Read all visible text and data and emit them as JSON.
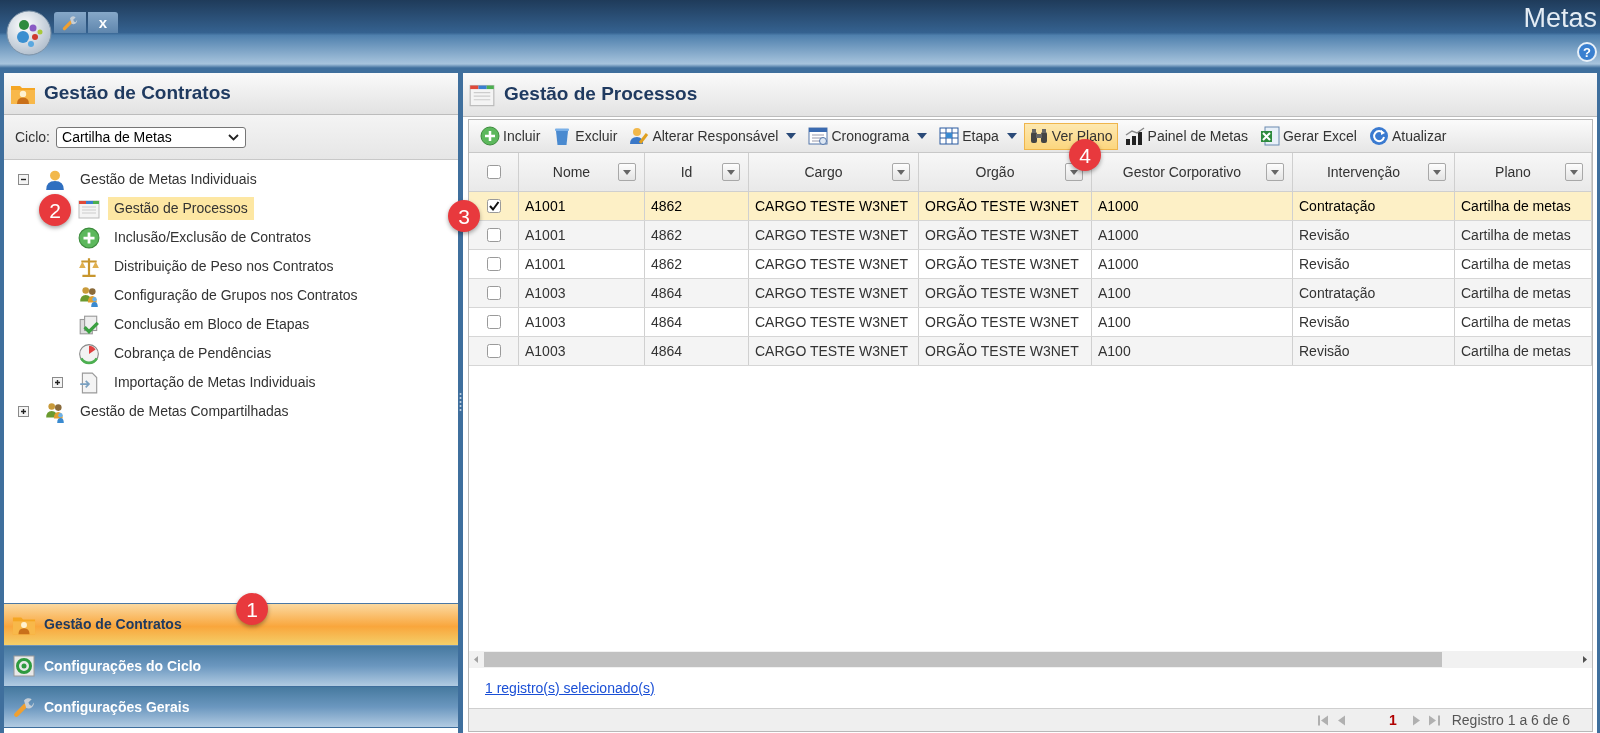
{
  "header": {
    "title": "Metas",
    "close_tab": "x",
    "help": "?"
  },
  "left_panel": {
    "title": "Gestão de Contratos",
    "cycle": {
      "label": "Ciclo:",
      "value": "Cartilha de Metas"
    },
    "tree": [
      {
        "label": "Gestão de Metas Individuais",
        "kind": "branch",
        "expanded": true,
        "selected": false,
        "children": [
          {
            "label": "Gestão de Processos",
            "kind": "leaf",
            "selected": true
          },
          {
            "label": "Inclusão/Exclusão de Contratos",
            "kind": "leaf",
            "selected": false
          },
          {
            "label": "Distribuição de Peso nos Contratos",
            "kind": "leaf",
            "selected": false
          },
          {
            "label": "Configuração de Grupos nos Contratos",
            "kind": "leaf",
            "selected": false
          },
          {
            "label": "Conclusão em Bloco de Etapas",
            "kind": "leaf",
            "selected": false
          },
          {
            "label": "Cobrança de Pendências",
            "kind": "leaf",
            "selected": false
          },
          {
            "label": "Importação de Metas Individuais",
            "kind": "branch",
            "expanded": false,
            "selected": false
          }
        ]
      },
      {
        "label": "Gestão de Metas Compartilhadas",
        "kind": "branch",
        "expanded": false,
        "selected": false
      }
    ]
  },
  "accordion": [
    {
      "label": "Gestão de Contratos",
      "selected": true
    },
    {
      "label": "Configurações do Ciclo",
      "selected": false
    },
    {
      "label": "Configurações Gerais",
      "selected": false
    }
  ],
  "main_panel": {
    "title": "Gestão de Processos",
    "toolbar": [
      {
        "label": "Incluir",
        "dropdown": false,
        "highlighted": false
      },
      {
        "label": "Excluir",
        "dropdown": false,
        "highlighted": false
      },
      {
        "label": "Alterar Responsável",
        "dropdown": true,
        "highlighted": false
      },
      {
        "label": "Cronograma",
        "dropdown": true,
        "highlighted": false
      },
      {
        "label": "Etapa",
        "dropdown": true,
        "highlighted": false
      },
      {
        "label": "Ver Plano",
        "dropdown": false,
        "highlighted": true
      },
      {
        "label": "Painel de Metas",
        "dropdown": false,
        "highlighted": false
      },
      {
        "label": "Gerar Excel",
        "dropdown": false,
        "highlighted": false
      },
      {
        "label": "Atualizar",
        "dropdown": false,
        "highlighted": false
      }
    ],
    "table": {
      "all_checked": false,
      "columns": [
        {
          "label": "Nome"
        },
        {
          "label": "Id"
        },
        {
          "label": "Cargo"
        },
        {
          "label": "Orgão"
        },
        {
          "label": "Gestor Corporativo"
        },
        {
          "label": "Intervenção"
        },
        {
          "label": "Plano"
        }
      ],
      "rows": [
        {
          "checked": true,
          "selected": true,
          "cells": [
            "A1001",
            "4862",
            "CARGO TESTE W3NET",
            "ORGÃO TESTE W3NET",
            "A1000",
            "Contratação",
            "Cartilha de metas"
          ]
        },
        {
          "checked": false,
          "selected": false,
          "cells": [
            "A1001",
            "4862",
            "CARGO TESTE W3NET",
            "ORGÃO TESTE W3NET",
            "A1000",
            "Revisão",
            "Cartilha de metas"
          ]
        },
        {
          "checked": false,
          "selected": false,
          "cells": [
            "A1001",
            "4862",
            "CARGO TESTE W3NET",
            "ORGÃO TESTE W3NET",
            "A1000",
            "Revisão",
            "Cartilha de metas"
          ]
        },
        {
          "checked": false,
          "selected": false,
          "cells": [
            "A1003",
            "4864",
            "CARGO TESTE W3NET",
            "ORGÃO TESTE W3NET",
            "A100",
            "Contratação",
            "Cartilha de metas"
          ]
        },
        {
          "checked": false,
          "selected": false,
          "cells": [
            "A1003",
            "4864",
            "CARGO TESTE W3NET",
            "ORGÃO TESTE W3NET",
            "A100",
            "Revisão",
            "Cartilha de metas"
          ]
        },
        {
          "checked": false,
          "selected": false,
          "cells": [
            "A1003",
            "4864",
            "CARGO TESTE W3NET",
            "ORGÃO TESTE W3NET",
            "A100",
            "Revisão",
            "Cartilha de metas"
          ]
        }
      ]
    },
    "selection_link": "1 registro(s) selecionado(s)",
    "pager": {
      "page": "1",
      "summary": "Registro 1 a 6 de 6"
    }
  },
  "annotations": [
    {
      "label": "1"
    },
    {
      "label": "2"
    },
    {
      "label": "3"
    },
    {
      "label": "4"
    }
  ]
}
